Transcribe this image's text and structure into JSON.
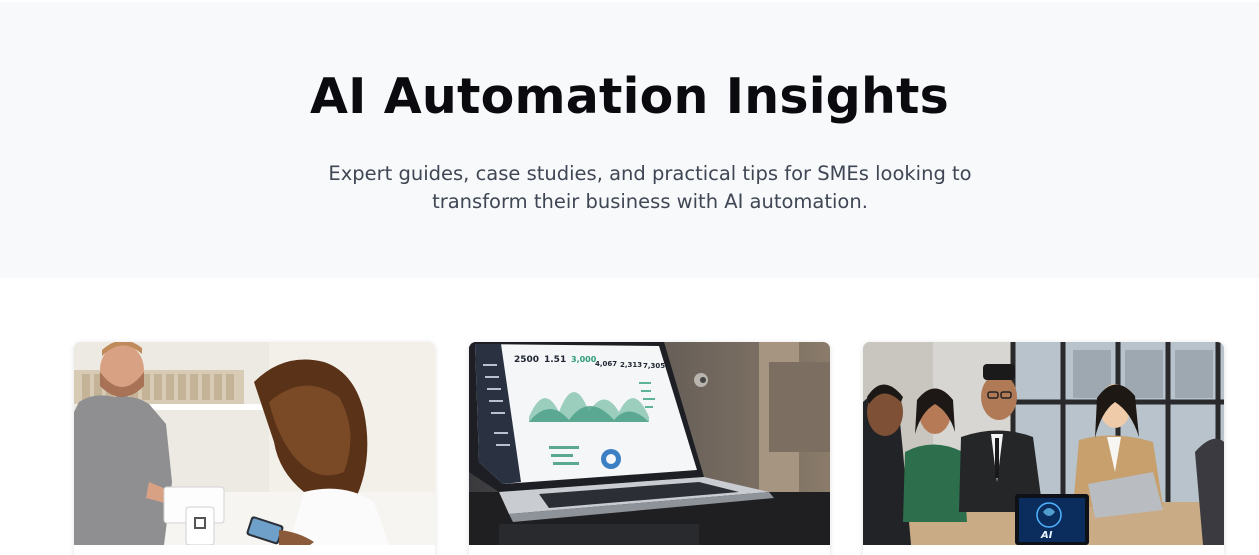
{
  "hero": {
    "title": "AI Automation Insights",
    "subtitle": "Expert guides, case studies, and practical tips for SMEs looking to transform their business with AI automation."
  },
  "cards": [
    {
      "image_kind": "photo",
      "photo_subject": "shop-counter-payment"
    },
    {
      "image_kind": "photo",
      "photo_subject": "laptop-dashboard",
      "dashboard_stats": [
        "2500",
        "1.51",
        "3,000",
        "4,067",
        "2,313",
        "7,305"
      ]
    },
    {
      "image_kind": "photo",
      "photo_subject": "team-meeting",
      "laptop_label": "AI"
    }
  ],
  "colors": {
    "hero_bg": "#f8f9fb",
    "title": "#0b0b0f",
    "subtitle": "#3f4654"
  }
}
